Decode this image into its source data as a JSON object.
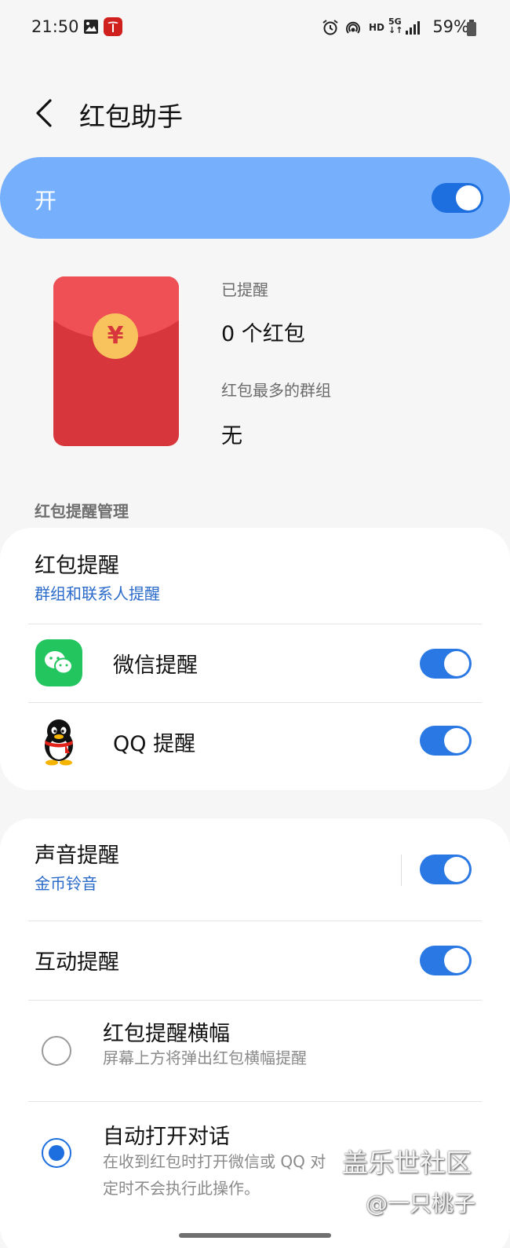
{
  "status_bar": {
    "time": "21:50",
    "battery": "59%",
    "icons": [
      "gallery-icon",
      "tesla-app-icon",
      "alarm-icon",
      "hotspot-icon",
      "hd-icon",
      "5g-icon",
      "signal-icon",
      "battery-icon"
    ],
    "hd_text": "HD",
    "fiveg_text": "5G"
  },
  "header": {
    "title": "红包助手",
    "back_icon": "chevron-left-icon"
  },
  "master_switch": {
    "label": "开",
    "on": true
  },
  "summary": {
    "reminded_label": "已提醒",
    "reminded_value": "0 个红包",
    "top_group_label": "红包最多的群组",
    "top_group_value": "无",
    "coin_symbol": "¥"
  },
  "section_reminder_management": {
    "header": "红包提醒管理",
    "reminder": {
      "title": "红包提醒",
      "subtitle": "群组和联系人提醒"
    },
    "apps": [
      {
        "label": "微信提醒",
        "icon": "wechat-icon",
        "on": true
      },
      {
        "label": "QQ 提醒",
        "icon": "qq-icon",
        "on": true
      }
    ]
  },
  "section_alerts": {
    "sound": {
      "title": "声音提醒",
      "subtitle": "金币铃音",
      "on": true
    },
    "interactive": {
      "title": "互动提醒",
      "on": true
    },
    "options": [
      {
        "title": "红包提醒横幅",
        "desc": "屏幕上方将弹出红包横幅提醒",
        "selected": false
      },
      {
        "title": "自动打开对话",
        "desc_line1": "在收到红包时打开微信或 QQ 对",
        "desc_line2": "定时不会执行此操作。",
        "selected": true
      }
    ]
  },
  "watermark": {
    "line1": "盖乐世社区",
    "line2": "@一只桃子"
  },
  "colors": {
    "background": "#f6f6f6",
    "master_bar": "#76b0fc",
    "toggle_on": "#2a78e4",
    "link_blue": "#2a6ac9",
    "envelope_red": "#d7373c"
  }
}
